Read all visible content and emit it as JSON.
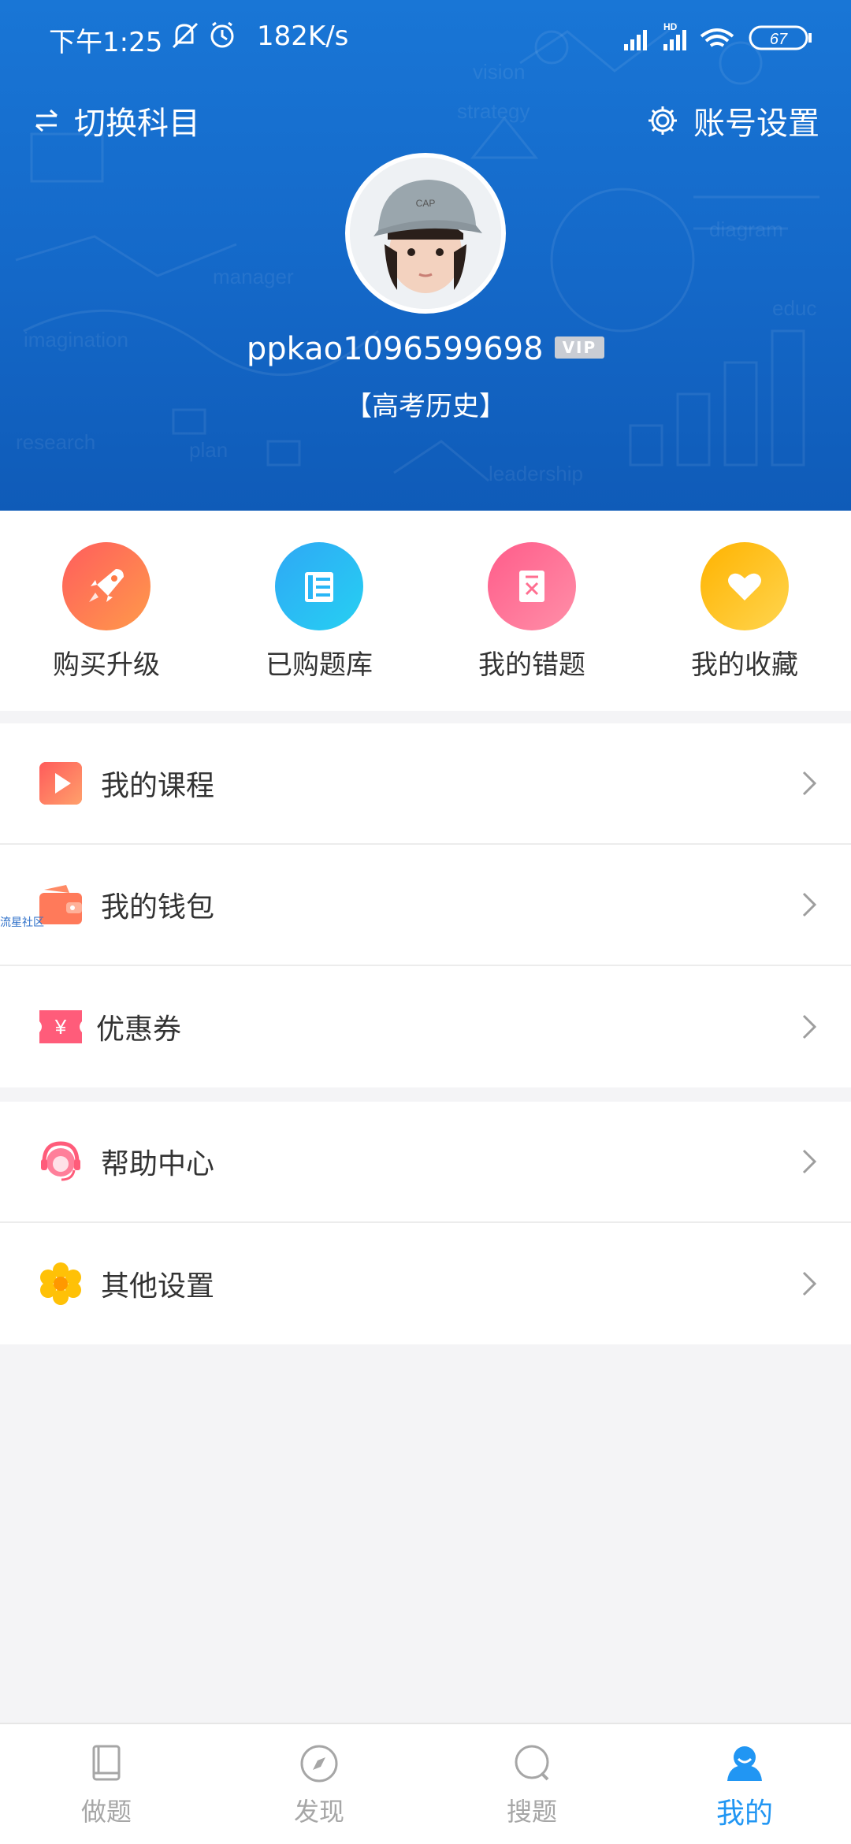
{
  "status_bar": {
    "time": "下午1:25",
    "speed": "182K/s",
    "battery": "67",
    "network": "HD"
  },
  "header": {
    "switch_label": "切换科目",
    "account_label": "账号设置",
    "username": "ppkao1096599698",
    "vip_badge": "VIP",
    "subject": "【高考历史】"
  },
  "quick_actions": [
    {
      "label": "购买升级",
      "icon": "rocket-icon",
      "color": "#ff7a45"
    },
    {
      "label": "已购题库",
      "icon": "book-list-icon",
      "color": "#29b6f6"
    },
    {
      "label": "我的错题",
      "icon": "wrong-question-icon",
      "color": "#ff6f91"
    },
    {
      "label": "我的收藏",
      "icon": "heart-icon",
      "color": "#ffc107"
    }
  ],
  "menu_group_1": [
    {
      "label": "我的课程",
      "icon": "play-icon"
    },
    {
      "label": "我的钱包",
      "icon": "wallet-icon"
    },
    {
      "label": "优惠券",
      "icon": "coupon-icon"
    }
  ],
  "menu_group_2": [
    {
      "label": "帮助中心",
      "icon": "customer-service-icon"
    },
    {
      "label": "其他设置",
      "icon": "flower-settings-icon"
    }
  ],
  "watermark": "流星社区",
  "bottom_nav": [
    {
      "label": "做题",
      "icon": "book-icon",
      "active": false
    },
    {
      "label": "发现",
      "icon": "compass-icon",
      "active": false
    },
    {
      "label": "搜题",
      "icon": "search-icon",
      "active": false
    },
    {
      "label": "我的",
      "icon": "user-icon",
      "active": true
    }
  ],
  "colors": {
    "header_blue": "#1468c8",
    "active_tab": "#2196f3",
    "background": "#f4f4f6"
  }
}
